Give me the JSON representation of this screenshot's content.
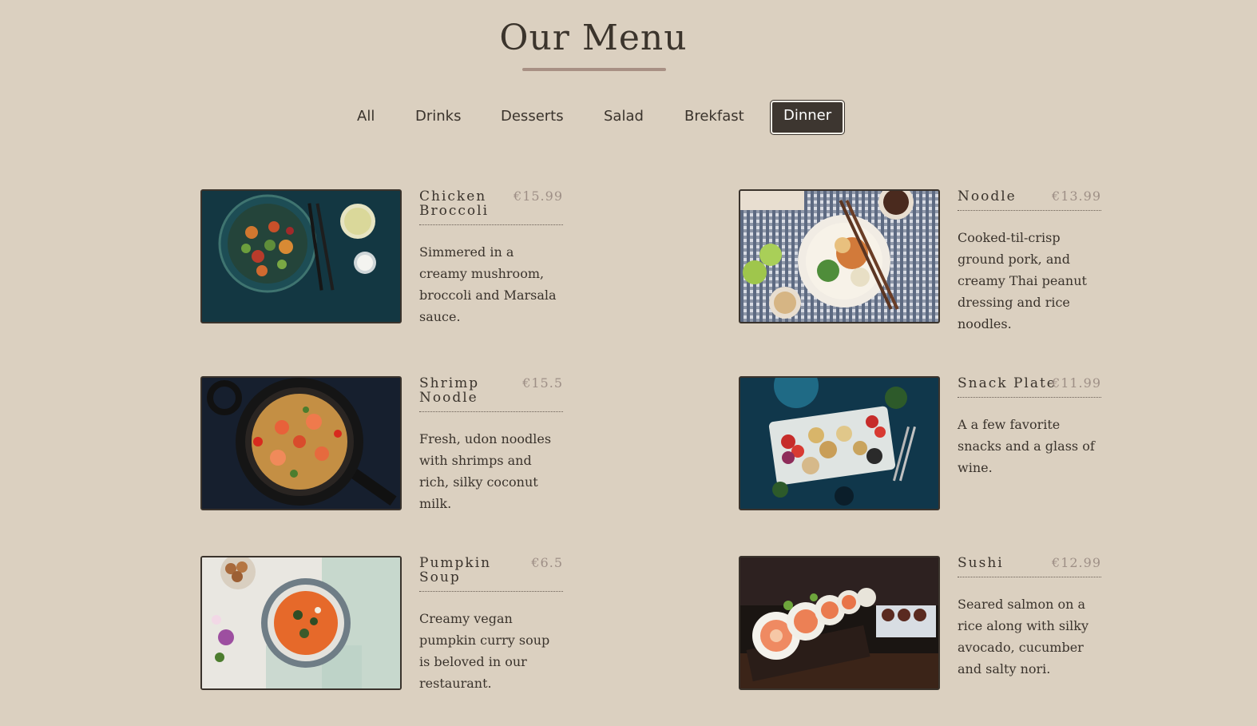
{
  "title": "Our Menu",
  "filters": [
    {
      "label": "All",
      "active": false
    },
    {
      "label": "Drinks",
      "active": false
    },
    {
      "label": "Desserts",
      "active": false
    },
    {
      "label": "Salad",
      "active": false
    },
    {
      "label": "Brekfast",
      "active": false
    },
    {
      "label": "Dinner",
      "active": true
    }
  ],
  "items": [
    {
      "name": "Chicken Broccoli",
      "price": "€15.99",
      "description": "Simmered in a creamy mushroom, broccoli and Marsala sauce.",
      "image": "chicken-broccoli-bowl"
    },
    {
      "name": "Noodle",
      "price": "€13.99",
      "description": "Cooked-til-crisp ground pork, and creamy Thai peanut dressing and rice noodles.",
      "image": "noodle-bowl"
    },
    {
      "name": "Shrimp Noodle",
      "price": "€15.5",
      "description": "Fresh, udon noodles with shrimps and rich, silky coconut milk.",
      "image": "shrimp-noodle-pan"
    },
    {
      "name": "Snack Plate",
      "price": "€11.99",
      "description": "A a few favorite snacks and a glass of wine.",
      "image": "snack-plate"
    },
    {
      "name": "Pumpkin Soup",
      "price": "€6.5",
      "description": "Creamy vegan pumpkin curry soup is beloved in our restaurant.",
      "image": "pumpkin-soup"
    },
    {
      "name": "Sushi",
      "price": "€12.99",
      "description": "Seared salmon on a rice along with silky avocado, cucumber and salty nori.",
      "image": "sushi-rolls"
    }
  ],
  "colors": {
    "background": "#dbd0c0",
    "text": "#3a332c",
    "price": "#9e8f86",
    "active_filter_bg": "#3d3630",
    "underline": "#a89084"
  }
}
